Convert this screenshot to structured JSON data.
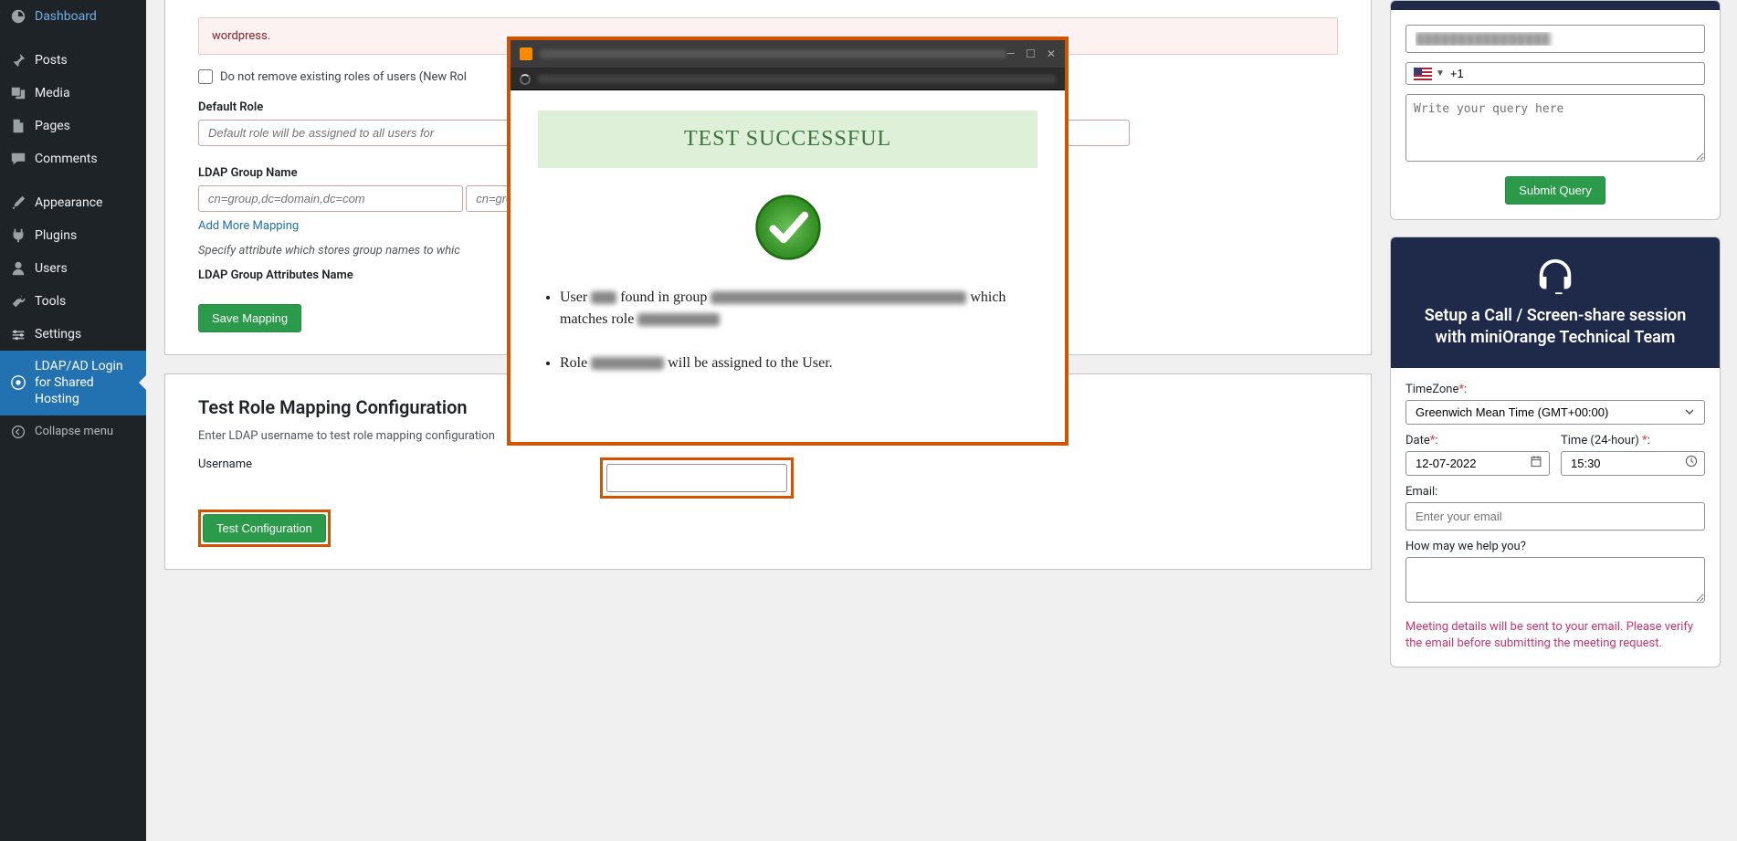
{
  "sidebar": {
    "items": [
      {
        "label": "Dashboard",
        "icon": "dashboard-icon"
      },
      {
        "label": "Posts",
        "icon": "pin-icon"
      },
      {
        "label": "Media",
        "icon": "media-icon"
      },
      {
        "label": "Pages",
        "icon": "pages-icon"
      },
      {
        "label": "Comments",
        "icon": "comments-icon"
      },
      {
        "label": "Appearance",
        "icon": "brush-icon"
      },
      {
        "label": "Plugins",
        "icon": "plug-icon"
      },
      {
        "label": "Users",
        "icon": "users-icon"
      },
      {
        "label": "Tools",
        "icon": "tools-icon"
      },
      {
        "label": "Settings",
        "icon": "settings-icon"
      },
      {
        "label": "LDAP/AD Login for Shared Hosting",
        "icon": "ldap-icon"
      }
    ],
    "collapse_label": "Collapse menu"
  },
  "main": {
    "warning_text": "wordpress.",
    "checkbox_label": "Do not remove existing roles of users (New Rol",
    "default_role_label": "Default Role",
    "default_role_placeholder": "Default role will be assigned to all users for ",
    "ldap_group_label": "LDAP Group Name",
    "ldap_group_placeholder": "cn=group,dc=domain,dc=com",
    "add_mapping_label": "Add More Mapping",
    "group_attr_help": "Specify attribute which stores group names to whic",
    "group_attr_label": "LDAP Group Attributes Name",
    "save_mapping_label": "Save Mapping",
    "test_section_title": "Test Role Mapping Configuration",
    "test_section_sub": "Enter LDAP username to test role mapping configuration",
    "username_label": "Username",
    "test_config_label": "Test Configuration"
  },
  "modal": {
    "banner": "TEST SUCCESSFUL",
    "msg1_a": "User ",
    "msg1_b": " found in group ",
    "msg1_c": " which matches role ",
    "msg2_a": "Role ",
    "msg2_b": " will be assigned to the User."
  },
  "rail": {
    "query_placeholder": "Write your query here",
    "phone_prefix": "+1",
    "submit_label": "Submit Query",
    "setup_title_line1": "Setup a Call / Screen-share session",
    "setup_title_line2": "with miniOrange Technical Team",
    "timezone_label": "TimeZone",
    "timezone_value": "Greenwich Mean Time (GMT+00:00)",
    "date_label": "Date",
    "date_value": "12-07-2022",
    "time_label": "Time (24-hour) ",
    "time_value": "15:30",
    "email_label": "Email:",
    "email_placeholder": "Enter your email",
    "help_label": "How may we help you?",
    "meeting_note": "Meeting details will be sent to your email. Please verify the email before submitting the meeting request."
  }
}
